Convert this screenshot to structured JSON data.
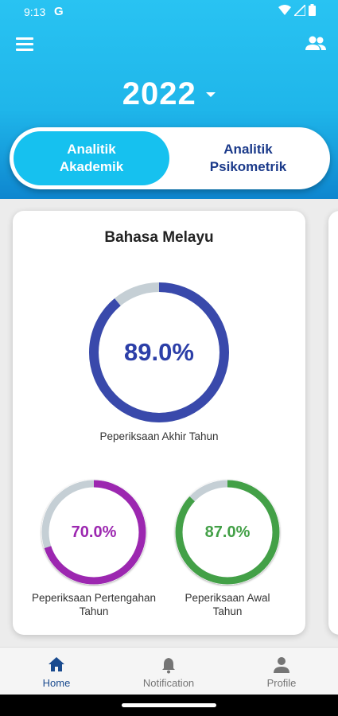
{
  "status_bar": {
    "time": "9:13",
    "g_label": "G"
  },
  "header": {
    "year": "2022"
  },
  "tabs": [
    {
      "label": "Analitik Akademik",
      "line1": "Analitik",
      "line2": "Akademik",
      "active": true
    },
    {
      "label": "Analitik Psikometrik",
      "line1": "Analitik",
      "line2": "Psikometrik",
      "active": false
    }
  ],
  "card": {
    "title": "Bahasa Melayu",
    "gauges": [
      {
        "value": 89.0,
        "value_text": "89.0%",
        "label": "Peperiksaan Akhir Tahun",
        "color": "#3949ab"
      },
      {
        "value": 70.0,
        "value_text": "70.0%",
        "label": "Peperiksaan Pertengahan Tahun",
        "color": "#9c27b0"
      },
      {
        "value": 87.0,
        "value_text": "87.0%",
        "label": "Peperiksaan Awal Tahun",
        "color": "#43a047"
      }
    ]
  },
  "bottom_nav": [
    {
      "label": "Home",
      "icon": "home-icon",
      "active": true
    },
    {
      "label": "Notification",
      "icon": "bell-icon",
      "active": false
    },
    {
      "label": "Profile",
      "icon": "person-icon",
      "active": false
    }
  ],
  "colors": {
    "accent": "#16c1ef",
    "nav_active": "#1a4b8f",
    "nav_inactive": "#757575",
    "track": "#c5cfd5"
  }
}
